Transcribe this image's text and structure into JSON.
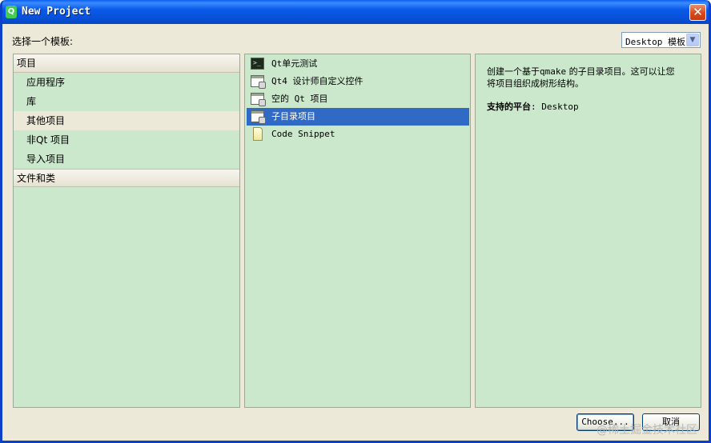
{
  "window": {
    "title": "New Project",
    "app_icon_glyph": "Q",
    "close_glyph": "✕"
  },
  "template_label": "选择一个模板:",
  "filter": {
    "selected": "Desktop 模板",
    "arrow_glyph": "▼"
  },
  "categories": {
    "section1": "项目",
    "items": [
      "应用程序",
      "库",
      "其他项目",
      "非Qt 项目",
      "导入项目"
    ],
    "selected_index": 2,
    "section2": "文件和类"
  },
  "templates": {
    "items": [
      {
        "label": "Qt单元测试",
        "icon": "terminal-icon"
      },
      {
        "label": "Qt4 设计师自定义控件",
        "icon": "window-icon"
      },
      {
        "label": "空的 Qt 项目",
        "icon": "window-icon"
      },
      {
        "label": "子目录项目",
        "icon": "window-icon"
      },
      {
        "label": "Code Snippet",
        "icon": "page-icon"
      }
    ],
    "selected_index": 3
  },
  "description": {
    "line1_pre": "创建一个基于",
    "line1_mono": "qmake",
    "line1_post": " 的子目录项目。这可以让您",
    "line2": "将项目组织成树形结构。",
    "platforms_label": "支持的平台",
    "platforms_value": ": Desktop"
  },
  "buttons": {
    "choose": "Choose...",
    "cancel": "取消"
  },
  "watermark": "@稀土掘金技术社区",
  "colors": {
    "titlebar": "#0a5ae8",
    "panel_bg": "#cbe8cc",
    "selection": "#316ac5",
    "dialog_bg": "#ece9d8"
  }
}
